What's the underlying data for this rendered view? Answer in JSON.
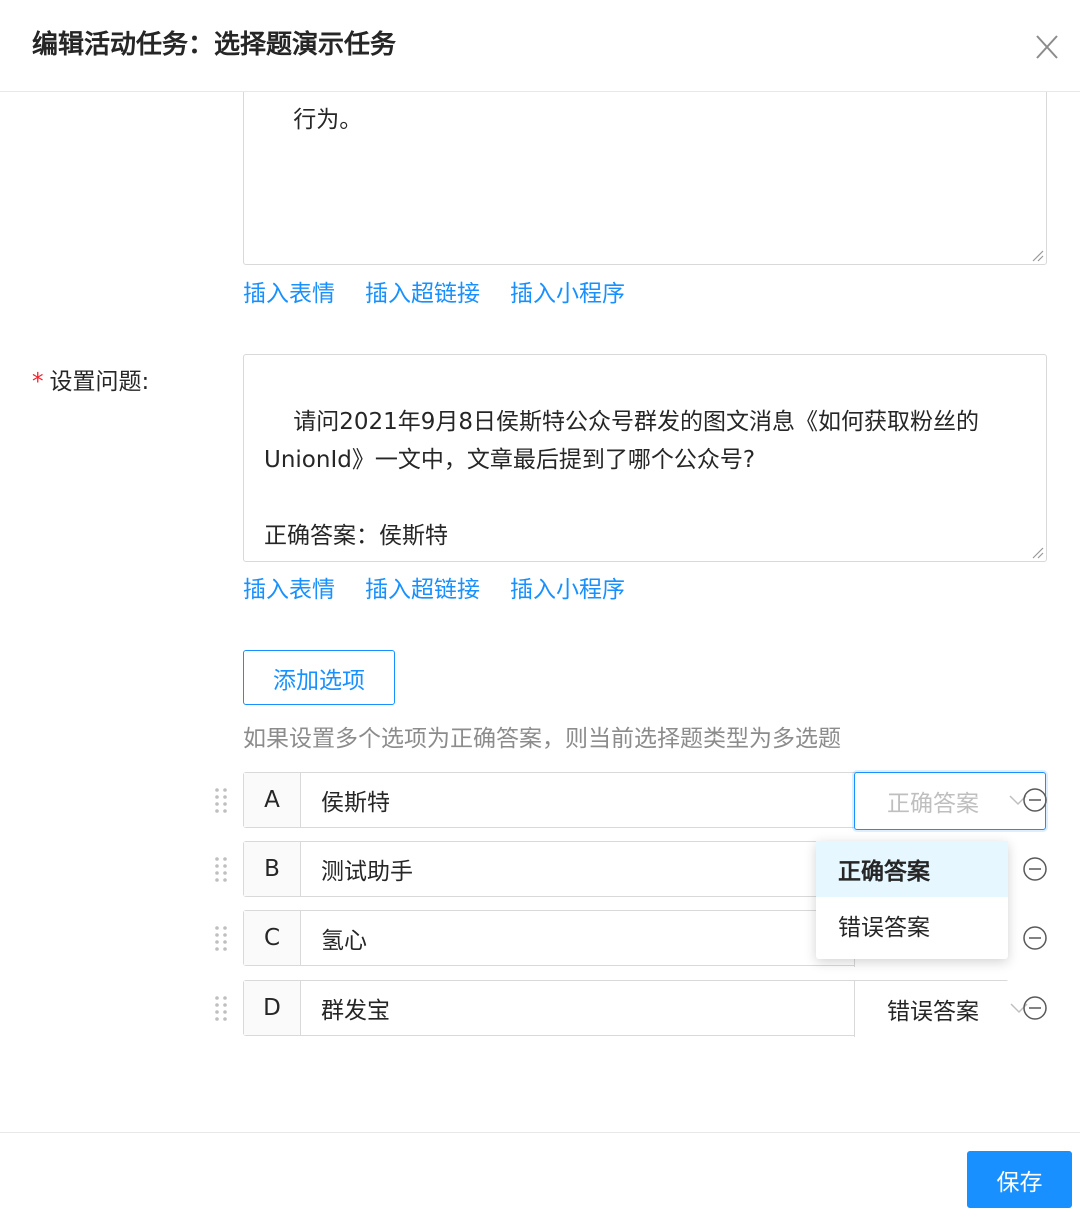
{
  "dialog": {
    "title": "编辑活动任务：选择题演示任务",
    "close_glyph": "X"
  },
  "task_desc": {
    "text": "行为。"
  },
  "insert_links": [
    "插入表情",
    "插入超链接",
    "插入小程序"
  ],
  "question": {
    "label": "设置问题:",
    "required_mark": "*",
    "text": "请问2021年9月8日侯斯特公众号群发的图文消息《如何获取粉丝的UnionId》一文中，文章最后提到了哪个公众号?\n\n正确答案：侯斯特"
  },
  "add_option_label": "添加选项",
  "hint": "如果设置多个选项为正确答案，则当前选择题类型为多选题",
  "options": [
    {
      "letter": "A",
      "text": "侯斯特",
      "answer": "正确答案"
    },
    {
      "letter": "B",
      "text": "测试助手",
      "answer": ""
    },
    {
      "letter": "C",
      "text": "氢心",
      "answer": ""
    },
    {
      "letter": "D",
      "text": "群发宝",
      "answer": "错误答案"
    }
  ],
  "answer_dropdown": {
    "items": [
      "正确答案",
      "错误答案"
    ],
    "highlighted": "正确答案"
  },
  "footer": {
    "save_label": "保存"
  },
  "colors": {
    "primary": "#1890ff",
    "required": "#f5222d",
    "hint": "#8c8c8c"
  }
}
